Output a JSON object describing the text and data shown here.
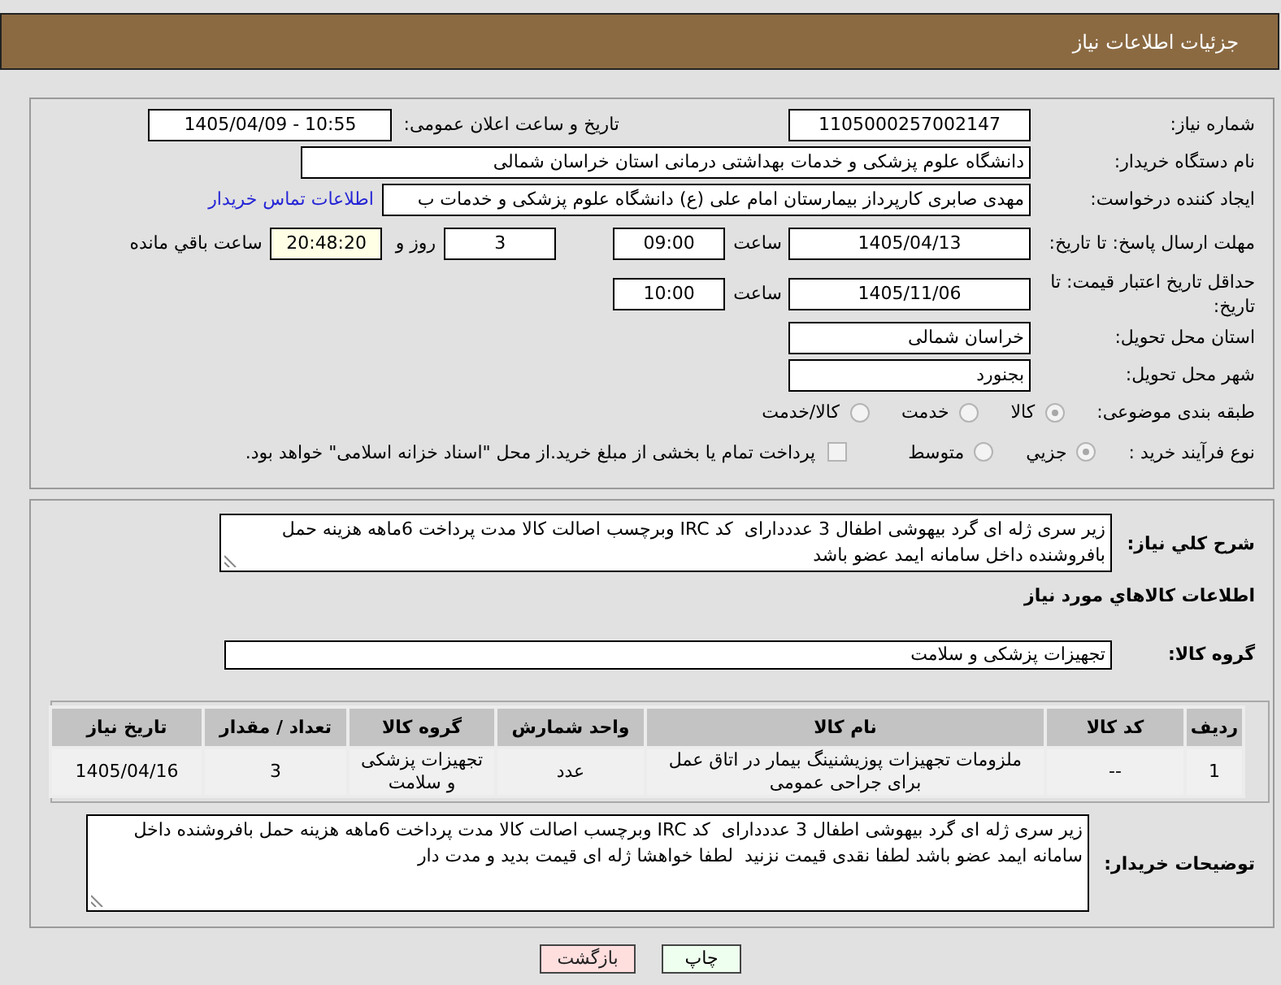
{
  "header": {
    "title": "جزئیات اطلاعات نیاز"
  },
  "need_details": {
    "need_number": {
      "label": "شماره نیاز:",
      "value": "1105000257002147"
    },
    "announcement": {
      "label": "تاریخ و ساعت اعلان عمومی:",
      "value": "1405/04/09 - 10:55"
    },
    "buyer_org": {
      "label": "نام دستگاه خریدار:",
      "value": "دانشگاه علوم پزشکی و خدمات بهداشتی درمانی استان خراسان شمالی"
    },
    "requester": {
      "label": "ایجاد کننده درخواست:",
      "value": "مهدی صابری کارپرداز بیمارستان امام علی (ع) دانشگاه علوم پزشکی و خدمات ب",
      "contact_link": "اطلاعات تماس خریدار"
    },
    "reply_deadline": {
      "label": "مهلت ارسال پاسخ: تا تاریخ:",
      "date": "1405/04/13",
      "time_label": "ساعت",
      "time": "09:00",
      "days": "3",
      "days_label": "روز و",
      "remaining": "20:48:20",
      "remaining_label": "ساعت باقي مانده"
    },
    "price_validity": {
      "label": "حداقل تاریخ اعتبار قیمت: تا تاریخ:",
      "date": "1405/11/06",
      "time_label": "ساعت",
      "time": "10:00"
    },
    "delivery_province": {
      "label": "استان محل تحویل:",
      "value": "خراسان شمالی"
    },
    "delivery_city": {
      "label": "شهر محل تحویل:",
      "value": "بجنورد"
    },
    "category": {
      "label": "طبقه بندی موضوعی:",
      "options": [
        {
          "label": "کالا",
          "selected": true
        },
        {
          "label": "خدمت",
          "selected": false
        },
        {
          "label": "کالا/خدمت",
          "selected": false
        }
      ]
    },
    "purchase_process": {
      "label": "نوع فرآیند خرید :",
      "options": [
        {
          "label": "جزيي",
          "selected": true
        },
        {
          "label": "متوسط",
          "selected": false
        }
      ],
      "treasury_payment": {
        "label": "پرداخت تمام یا بخشی از مبلغ خرید.از محل \"اسناد خزانه اسلامی\" خواهد بود.",
        "checked": false
      }
    }
  },
  "description": {
    "label": "شرح کلي نیاز:",
    "value": "زیر سری ژله ای گرد بیهوشی اطفال 3 عدددارای  کد IRC وبرچسب اصالت کالا مدت پرداخت 6ماهه هزینه حمل بافروشنده داخل سامانه ایمد عضو باشد"
  },
  "goods_section": {
    "title": "اطلاعات کالاهاي مورد نیاز",
    "group_label": "گروه کالا:",
    "group_value": "تجهیزات پزشکی و سلامت"
  },
  "table": {
    "columns": [
      "ردیف",
      "کد کالا",
      "نام کالا",
      "واحد شمارش",
      "گروه کالا",
      "تعداد / مقدار",
      "تاریخ نیاز"
    ],
    "rows": [
      [
        "1",
        "--",
        "ملزومات تجهیزات پوزیشنینگ بیمار در اتاق عمل برای جراحی عمومی",
        "عدد",
        "تجهیزات پزشکی و سلامت",
        "3",
        "1405/04/16"
      ]
    ]
  },
  "buyer_notes": {
    "label": "توضیحات خریدار:",
    "value": "زیر سری ژله ای گرد بیهوشی اطفال 3 عدددارای  کد IRC وبرچسب اصالت کالا مدت پرداخت 6ماهه هزینه حمل بافروشنده داخل سامانه ایمد عضو باشد لطفا نقدی قیمت نزنید  لطفا خواهشا ژله ای قیمت بدید و مدت دار"
  },
  "buttons": [
    {
      "label": "چاپ",
      "kind": "print"
    },
    {
      "label": "بازگشت",
      "kind": "back"
    }
  ]
}
